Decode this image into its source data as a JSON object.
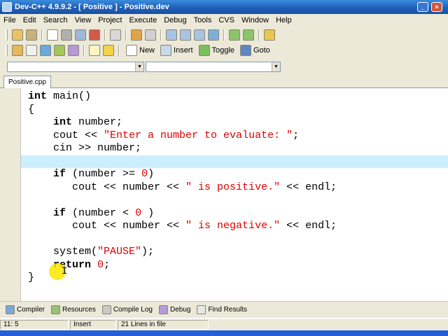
{
  "window": {
    "title": "Dev-C++ 4.9.9.2 - [ Positive ] - Positive.dev"
  },
  "menu": [
    "File",
    "Edit",
    "Search",
    "View",
    "Project",
    "Execute",
    "Debug",
    "Tools",
    "CVS",
    "Window",
    "Help"
  ],
  "toolbar2": {
    "new_label": "New",
    "insert_label": "Insert",
    "toggle_label": "Toggle",
    "goto_label": "Goto"
  },
  "editor_tab": "Positive.cpp",
  "code_lines": [
    "int main()",
    "{",
    "    int number;",
    "    cout << \"Enter a number to evaluate: \";",
    "    cin >> number;",
    "",
    "    if (number >= 0)",
    "       cout << number << \" is positive.\" << endl;",
    "",
    "    if (number < 0 )",
    "       cout << number << \" is negative.\" << endl;",
    "",
    "    system(\"PAUSE\");",
    "    return 0;",
    "}"
  ],
  "active_line_index": 5,
  "bottom_tabs": [
    "Compiler",
    "Resources",
    "Compile Log",
    "Debug",
    "Find Results"
  ],
  "status": {
    "position": "11: 5",
    "mode": "Insert",
    "lines": "21 Lines in file"
  },
  "colors": {
    "title_bar": "#1f5fb8",
    "chrome": "#ece9d8",
    "active_line": "#ccefff",
    "string": "#e00000"
  }
}
